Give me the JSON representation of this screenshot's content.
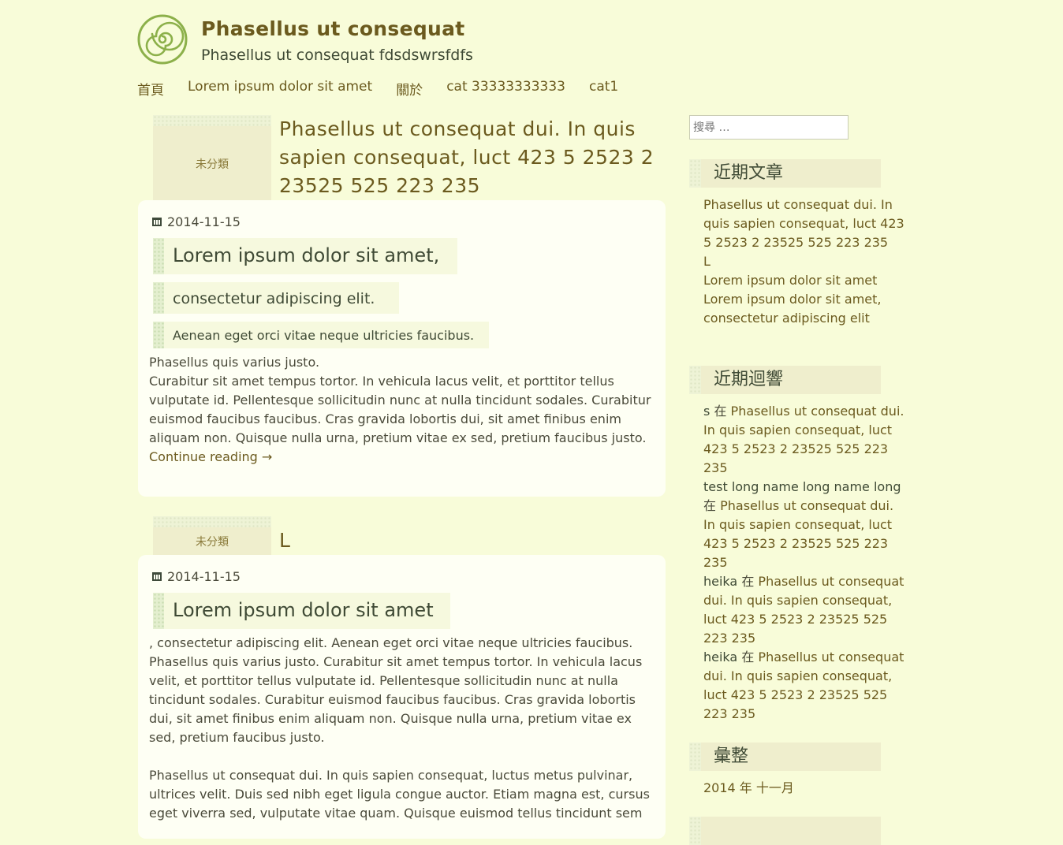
{
  "site": {
    "title": "Phasellus ut consequat",
    "description": "Phasellus ut consequat fdsdswrsfdfs",
    "logo_icon": "spiral-icon",
    "colors": {
      "background": "#f8fcd9",
      "accent": "#6b5a1e",
      "card": "#fefff4",
      "tag_bg": "#efeecd"
    }
  },
  "nav": {
    "items": [
      {
        "label": "首頁"
      },
      {
        "label": "Lorem ipsum dolor sit amet"
      },
      {
        "label": "關於"
      },
      {
        "label": "cat 33333333333"
      },
      {
        "label": "cat1"
      }
    ]
  },
  "posts": [
    {
      "category": "未分類",
      "title": "Phasellus ut consequat dui. In quis sapien consequat, luct 423 5 2523 2 23525 525 223 235",
      "date": "2014-11-15",
      "h1": "Lorem ipsum dolor sit amet,",
      "h2": "consectetur adipiscing elit.",
      "h3": "Aenean eget orci vitae neque ultricies faucibus.",
      "p1": "Phasellus quis varius justo.",
      "p2": "Curabitur sit amet tempus tortor. In vehicula lacus velit, et porttitor tellus vulputate id. Pellentesque sollicitudin nunc at nulla tincidunt sodales. Curabitur euismod faucibus faucibus. Cras gravida lobortis dui, sit amet finibus enim aliquam non. Quisque nulla urna, pretium vitae ex sed, pretium faucibus justo.",
      "more": "Continue reading →"
    },
    {
      "category": "未分類",
      "title": "L",
      "date": "2014-11-15",
      "h1": "Lorem ipsum dolor sit amet",
      "p1": ", consectetur adipiscing elit. Aenean eget orci vitae neque ultricies faucibus. Phasellus quis varius justo. Curabitur sit amet tempus tortor. In vehicula lacus velit, et porttitor tellus vulputate id. Pellentesque sollicitudin nunc at nulla tincidunt sodales. Curabitur euismod faucibus faucibus. Cras gravida lobortis dui, sit amet finibus enim aliquam non. Quisque nulla urna, pretium vitae ex sed, pretium faucibus justo.",
      "p2": "Phasellus ut consequat dui. In quis sapien consequat, luctus metus pulvinar, ultrices velit. Duis sed nibh eget ligula congue auctor. Etiam magna est, cursus eget viverra sed, vulputate vitae quam. Quisque euismod tellus tincidunt sem"
    }
  ],
  "sidebar": {
    "search_placeholder": "搜尋 …",
    "recent_posts": {
      "title": "近期文章",
      "items": [
        "Phasellus ut consequat dui. In quis sapien consequat, luct 423 5 2523 2 23525 525 223 235",
        "L",
        "Lorem ipsum dolor sit amet",
        "Lorem ipsum dolor sit amet, consectetur adipiscing elit"
      ]
    },
    "recent_comments": {
      "title": "近期迴響",
      "in_word": "在",
      "items": [
        {
          "author": "s",
          "post": "Phasellus ut consequat dui. In quis sapien consequat, luct 423 5 2523 2 23525 525 223 235"
        },
        {
          "author": "test long name long name long",
          "post": "Phasellus ut consequat dui. In quis sapien consequat, luct 423 5 2523 2 23525 525 223 235"
        },
        {
          "author": "heika",
          "post": "Phasellus ut consequat dui. In quis sapien consequat, luct 423 5 2523 2 23525 525 223 235"
        },
        {
          "author": "heika",
          "post": "Phasellus ut consequat dui. In quis sapien consequat, luct 423 5 2523 2 23525 525 223 235"
        }
      ]
    },
    "archives": {
      "title": "彙整",
      "items": [
        "2014 年 十一月"
      ]
    }
  }
}
